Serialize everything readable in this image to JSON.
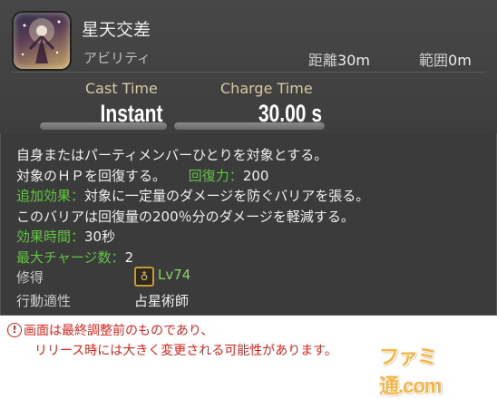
{
  "action": {
    "icon": "star-sign-icon",
    "name": "星天交差",
    "type": "アビリティ",
    "range_label": "距離",
    "range_value": "30m",
    "radius_label": "範囲",
    "radius_value": "0m"
  },
  "timing": {
    "cast_label": "Cast Time",
    "cast_value": "Instant",
    "cast_bar_fill": 1.0,
    "recast_label": "Charge Time",
    "recast_value": "30.00 s",
    "recast_bar_fill": 1.0
  },
  "description": {
    "line1": "自身またはパーティメンバーひとりを対象とする。",
    "line2a": "対象のＨＰを回復する。",
    "line2_label": "回復力：",
    "line2_value": "200",
    "line3_label": "追加効果：",
    "line3_text": "対象に一定量のダメージを防ぐバリアを張る。",
    "line4": "このバリアは回復量の200％分のダメージを軽減する。",
    "line5_label": "効果時間：",
    "line5_value": "30秒",
    "line6_label": "最大チャージ数：",
    "line6_value": "2"
  },
  "footer": {
    "acquired_label": "修得",
    "acquired_icon": "astrologian-job-icon",
    "acquired_level": "Lv74",
    "affinity_label": "行動適性",
    "affinity_value": "占星術師"
  },
  "notice": {
    "warn_icon": "warning-icon",
    "line1": "画面は最終調整前のものであり、",
    "line2": "リリース時には大きく変更される可能性があります。",
    "watermark": "ファミ通.com"
  },
  "colors": {
    "panel": "#3b3b3b",
    "label_gold": "#d8c9a6",
    "green": "#61c540",
    "notice_red": "#d7261e"
  }
}
